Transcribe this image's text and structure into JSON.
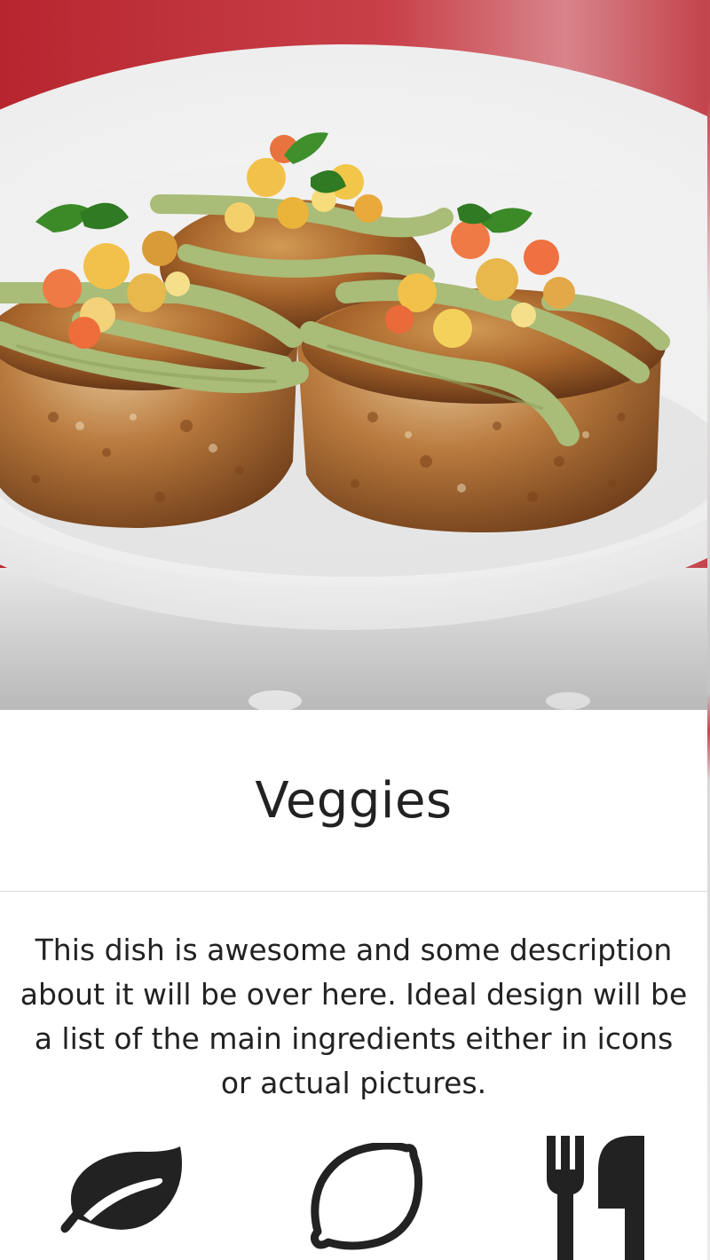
{
  "dish": {
    "title": "Veggies",
    "description": "This dish is awesome and some description about it will be over here. Ideal design will be a list of the main ingredients either in icons or actual pictures.",
    "photo_icon": "food-photo"
  },
  "ingredients": [
    {
      "icon": "leaf-icon"
    },
    {
      "icon": "lemon-icon"
    },
    {
      "icon": "fork-knife-icon"
    }
  ],
  "colors": {
    "text": "#222222",
    "background": "#ffffff",
    "divider": "#dcdcdc",
    "icon": "#222222",
    "accent_red": "#c2484f"
  }
}
